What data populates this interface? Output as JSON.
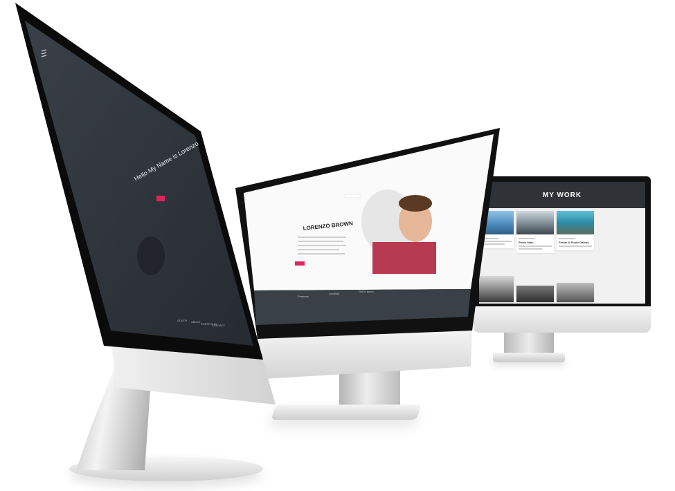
{
  "left_screen": {
    "hero_title": "Hello My Name is Lorenzo",
    "nav_items": [
      "SOUTH",
      "ABOUT",
      "PORTFOLIO",
      "CONTACT"
    ]
  },
  "middle_screen": {
    "name": "LORENZO BROWN",
    "footer_columns": [
      "Features",
      "Location",
      "Get in touch"
    ]
  },
  "right_screen": {
    "section_title": "MY WORK",
    "cards": [
      {
        "title": ""
      },
      {
        "title": "Photo Main"
      },
      {
        "title": "Forum & Photo Gallery"
      }
    ]
  },
  "colors": {
    "accent": "#e0245e",
    "dark_screen": "#2b3036",
    "footer_dark": "#3a4047"
  }
}
